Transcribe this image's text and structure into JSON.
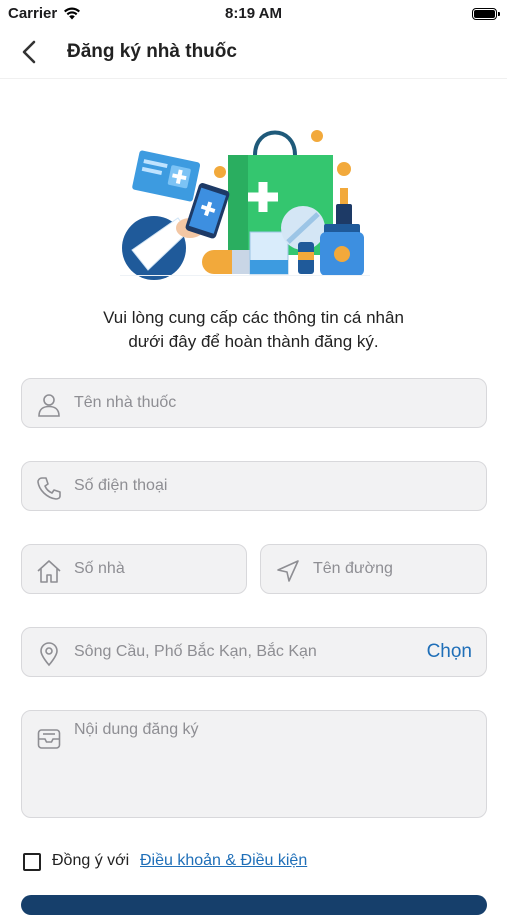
{
  "status_bar": {
    "carrier": "Carrier",
    "time": "8:19 AM"
  },
  "nav": {
    "title": "Đăng ký nhà thuốc"
  },
  "intro": {
    "line1": "Vui lòng cung cấp các thông tin cá nhân",
    "line2": "dưới đây để hoàn thành đăng ký."
  },
  "form": {
    "pharmacy_name": {
      "placeholder": "Tên nhà thuốc",
      "icon": "user-icon"
    },
    "phone": {
      "placeholder": "Số điện thoại",
      "icon": "phone-icon"
    },
    "house_number": {
      "placeholder": "Số nhà",
      "icon": "home-icon"
    },
    "street": {
      "placeholder": "Tên đường",
      "icon": "navigation-arrow-icon"
    },
    "area": {
      "value": "Sông Cầu, Phố Bắc Kạn, Bắc Kạn",
      "choose_label": "Chọn",
      "icon": "location-pin-icon"
    },
    "content": {
      "placeholder": "Nội dung đăng ký",
      "icon": "inbox-icon"
    }
  },
  "agreement": {
    "label": "Đồng ý với",
    "link": "Điều khoản & Điều kiện",
    "checked": false
  },
  "colors": {
    "accent": "#1f6fb8",
    "primary_button": "#163f6b",
    "field_bg": "#f2f2f3"
  }
}
